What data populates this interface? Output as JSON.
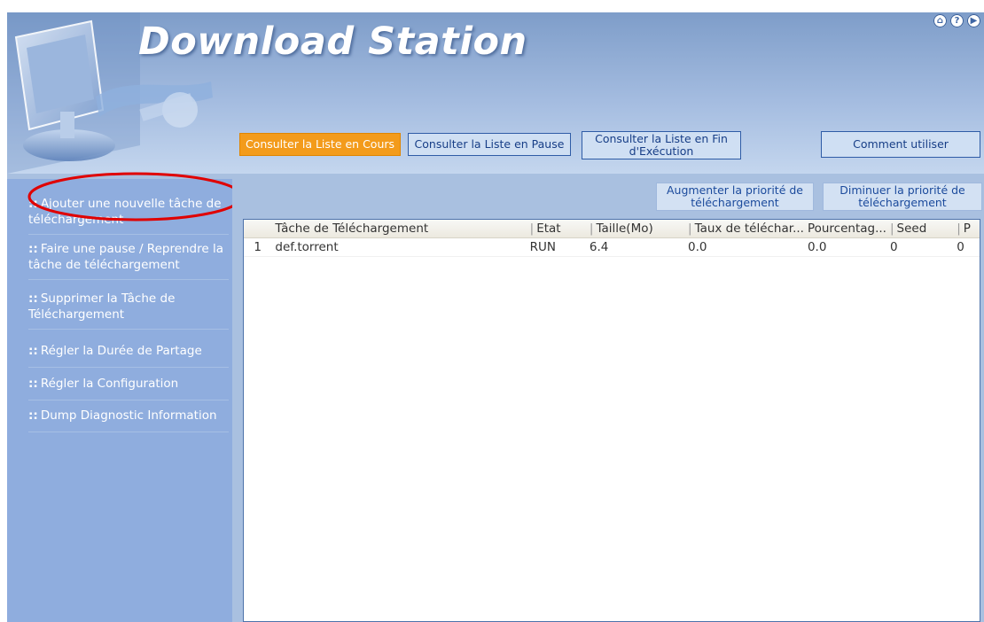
{
  "header": {
    "title": "Download Station",
    "icons": [
      "home-icon",
      "help-icon",
      "next-icon"
    ]
  },
  "tabs": [
    {
      "label": "Consulter la Liste en Cours",
      "active": true
    },
    {
      "label": "Consulter la Liste en Pause",
      "active": false
    },
    {
      "label": "Consulter la Liste en Fin d'Exécution",
      "active": false
    },
    {
      "label": "Comment utiliser",
      "active": false
    }
  ],
  "sidebar": {
    "items": [
      {
        "label": "Ajouter une nouvelle tâche de téléchargement"
      },
      {
        "label": "Faire une pause / Reprendre la tâche de téléchargement"
      },
      {
        "label": "Supprimer la Tâche de Téléchargement"
      },
      {
        "label": "Régler la Durée de Partage"
      },
      {
        "label": "Régler la Configuration"
      },
      {
        "label": "Dump Diagnostic Information"
      }
    ]
  },
  "toolbar": {
    "increase_priority": "Augmenter la priorité de téléchargement",
    "decrease_priority": "Diminuer la priorité de téléchargement"
  },
  "table": {
    "columns": [
      "Tâche de Téléchargement",
      "Etat",
      "Taille(Mo)",
      "Taux de téléchar...",
      "Pourcentag...",
      "Seed",
      "P"
    ],
    "rows": [
      {
        "num": "1",
        "cells": [
          "def.torrent",
          "RUN",
          "6.4",
          "0.0",
          "0.0",
          "0",
          "0"
        ]
      }
    ]
  },
  "colors": {
    "active_tab": "#f39b1b",
    "sidebar": "#8fadde",
    "highlight": "#e00000"
  }
}
